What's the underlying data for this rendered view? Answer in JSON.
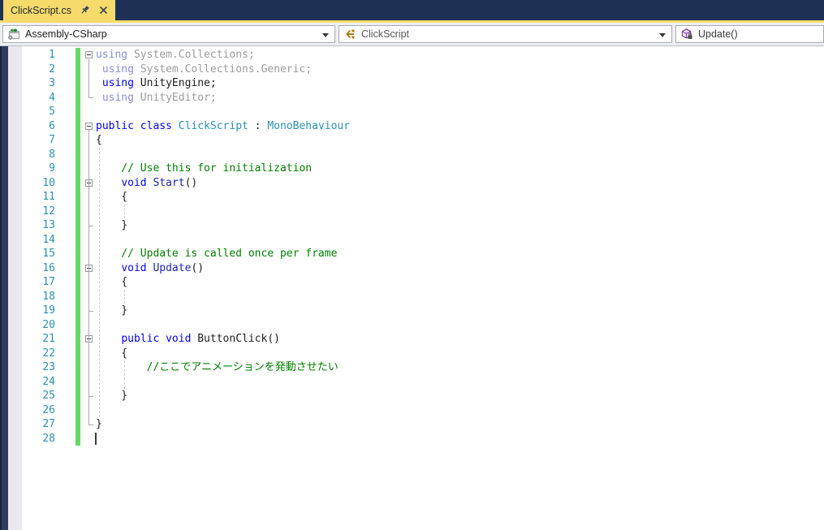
{
  "tab_bar": {
    "tabs": [
      {
        "label": "ClickScript.cs",
        "active": true
      }
    ],
    "pin_icon": "pin-icon",
    "close_icon": "close-icon"
  },
  "nav_bar": {
    "project": {
      "label": "Assembly-CSharp",
      "icon": "csharp-project-icon"
    },
    "type": {
      "label": "ClickScript",
      "icon": "class-icon"
    },
    "member": {
      "label": "Update()",
      "icon": "method-private-icon"
    }
  },
  "colors": {
    "tab_accent": "#f6db6b",
    "tabbar_bg": "#1c3154",
    "keyword": "#0000ff",
    "keyword_faded": "#8d8de3",
    "text_faded": "#9c9c9c",
    "type": "#2b91af",
    "method": "#2125ad",
    "comment": "#008000",
    "code_text": "#1e1e1e",
    "line_number": "#2b91af",
    "change_bar": "#63d863"
  },
  "editor": {
    "language": "csharp",
    "lines": [
      {
        "n": 1,
        "fold": true,
        "segs": [
          [
            "kwf",
            "using"
          ],
          [
            "dim",
            " System.Collections;"
          ]
        ]
      },
      {
        "n": 2,
        "segs": [
          [
            "kwf",
            " using"
          ],
          [
            "dim",
            " System.Collections.Generic;"
          ]
        ]
      },
      {
        "n": 3,
        "segs": [
          [
            "kw",
            " using"
          ],
          [
            "pln",
            " UnityEngine;"
          ]
        ]
      },
      {
        "n": 4,
        "segs": [
          [
            "kwf",
            " using"
          ],
          [
            "dim",
            " UnityEditor;"
          ]
        ]
      },
      {
        "n": 5,
        "segs": []
      },
      {
        "n": 6,
        "fold": true,
        "segs": [
          [
            "kw",
            "public class "
          ],
          [
            "typ",
            "ClickScript"
          ],
          [
            "pln",
            " : "
          ],
          [
            "typ",
            "MonoBehaviour"
          ]
        ]
      },
      {
        "n": 7,
        "segs": [
          [
            "pln",
            "{"
          ]
        ]
      },
      {
        "n": 8,
        "segs": []
      },
      {
        "n": 9,
        "segs": [
          [
            "com",
            "    // Use this for initialization"
          ]
        ]
      },
      {
        "n": 10,
        "fold": true,
        "segs": [
          [
            "pln",
            "    "
          ],
          [
            "kw",
            "void"
          ],
          [
            "pln",
            " "
          ],
          [
            "mth",
            "Start"
          ],
          [
            "pln",
            "()"
          ]
        ]
      },
      {
        "n": 11,
        "segs": [
          [
            "pln",
            "    {"
          ]
        ]
      },
      {
        "n": 12,
        "segs": []
      },
      {
        "n": 13,
        "segs": [
          [
            "pln",
            "    }"
          ]
        ]
      },
      {
        "n": 14,
        "segs": []
      },
      {
        "n": 15,
        "segs": [
          [
            "com",
            "    // Update is called once per frame"
          ]
        ]
      },
      {
        "n": 16,
        "fold": true,
        "segs": [
          [
            "pln",
            "    "
          ],
          [
            "kw",
            "void"
          ],
          [
            "pln",
            " "
          ],
          [
            "mth",
            "Update"
          ],
          [
            "pln",
            "()"
          ]
        ]
      },
      {
        "n": 17,
        "segs": [
          [
            "pln",
            "    {"
          ]
        ]
      },
      {
        "n": 18,
        "segs": []
      },
      {
        "n": 19,
        "segs": [
          [
            "pln",
            "    }"
          ]
        ]
      },
      {
        "n": 20,
        "segs": []
      },
      {
        "n": 21,
        "fold": true,
        "segs": [
          [
            "pln",
            "    "
          ],
          [
            "kw",
            "public void"
          ],
          [
            "pln",
            " ButtonClick()"
          ]
        ]
      },
      {
        "n": 22,
        "segs": [
          [
            "pln",
            "    {"
          ]
        ]
      },
      {
        "n": 23,
        "segs": [
          [
            "com",
            "        //ここでアニメーションを発動させたい"
          ]
        ]
      },
      {
        "n": 24,
        "segs": []
      },
      {
        "n": 25,
        "segs": [
          [
            "pln",
            "    }"
          ]
        ]
      },
      {
        "n": 26,
        "segs": []
      },
      {
        "n": 27,
        "segs": [
          [
            "pln",
            "}"
          ]
        ]
      },
      {
        "n": 28,
        "segs": [],
        "caret": true
      }
    ],
    "outline": {
      "runs": [
        {
          "start": 1,
          "end": 4
        },
        {
          "start": 6,
          "end": 27
        }
      ],
      "ticks": [
        13,
        19,
        25
      ]
    },
    "guides": [
      {
        "col": 0,
        "from": 8,
        "to": 26
      },
      {
        "col": 4,
        "from": 12,
        "to": 12
      },
      {
        "col": 4,
        "from": 18,
        "to": 18
      },
      {
        "col": 4,
        "from": 23,
        "to": 24
      }
    ],
    "change_bar_lines": {
      "from": 1,
      "to": 28
    }
  }
}
